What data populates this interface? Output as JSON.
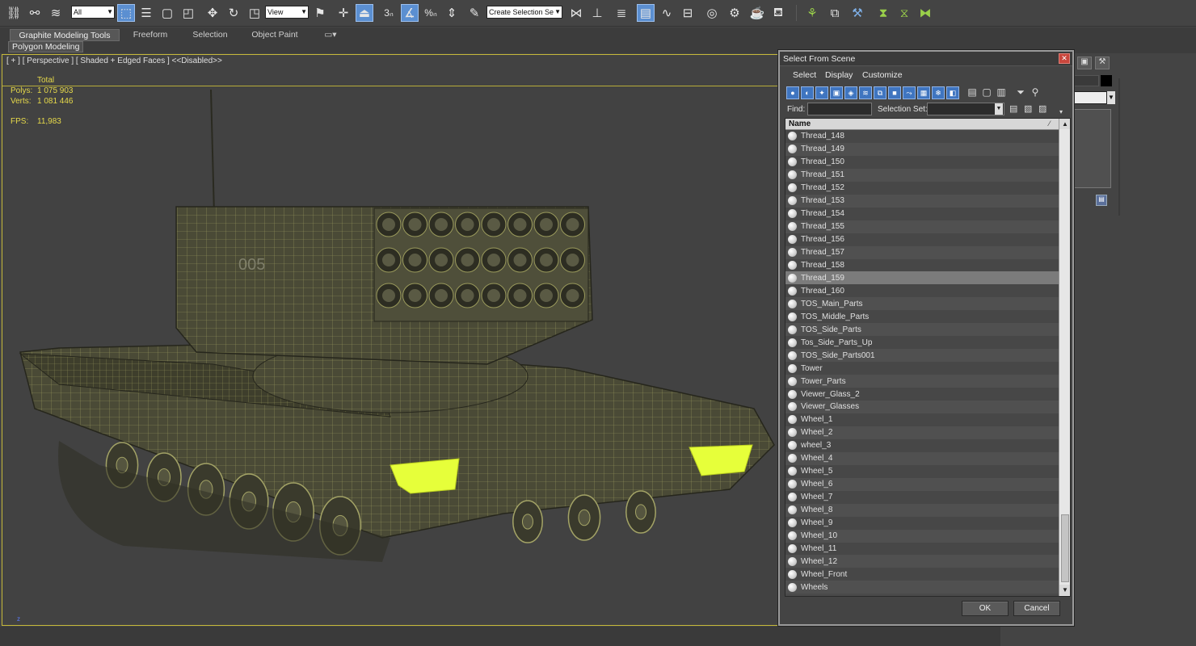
{
  "toolbar": {
    "selection_filter": "All",
    "reference_coord": "View",
    "snap_label": "3",
    "angle_snap": "%",
    "named_selection_placeholder": "Create Selection Se",
    "icons": [
      "link-icon",
      "unlink-icon",
      "bind-spacewarp-icon",
      "select-object-icon",
      "select-by-name-icon",
      "rect-region-icon",
      "window-crossing-icon",
      "move-icon",
      "rotate-icon",
      "scale-icon",
      "select-manipulate-icon",
      "pivot-icon",
      "snap-toggle-icon",
      "angle-snap-icon",
      "percent-snap-icon",
      "spinner-snap-icon",
      "edit-named-sets-icon",
      "mirror-icon",
      "align-icon",
      "layer-manager-icon",
      "graphite-toggle-icon",
      "curve-editor-icon",
      "schematic-view-icon",
      "material-editor-icon",
      "render-setup-icon",
      "rendered-frame-icon",
      "render-icon",
      "render-iterative-icon"
    ]
  },
  "ribbon": {
    "tabs": [
      "Graphite Modeling Tools",
      "Freeform",
      "Selection",
      "Object Paint"
    ],
    "active_tab": "Graphite Modeling Tools",
    "panel_label": "Polygon Modeling"
  },
  "viewport": {
    "label": "[ + ] [ Perspective ] [ Shaded + Edged Faces ] <<Disabled>>",
    "stats_header": "Total",
    "polys_label": "Polys:",
    "polys_value": "1 075 903",
    "verts_label": "Verts:",
    "verts_value": "1 081 446",
    "fps_label": "FPS:",
    "fps_value": "11,983",
    "hull_number": "005",
    "axis_label": "z"
  },
  "dialog": {
    "title": "Select From Scene",
    "menu": [
      "Select",
      "Display",
      "Customize"
    ],
    "find_label": "Find:",
    "find_value": "",
    "selection_set_label": "Selection Set:",
    "selection_set_value": "",
    "column_header": "Name",
    "items": [
      "Thread_148",
      "Thread_149",
      "Thread_150",
      "Thread_151",
      "Thread_152",
      "Thread_153",
      "Thread_154",
      "Thread_155",
      "Thread_156",
      "Thread_157",
      "Thread_158",
      "Thread_159",
      "Thread_160",
      "TOS_Main_Parts",
      "TOS_Middle_Parts",
      "TOS_Side_Parts",
      "Tos_Side_Parts_Up",
      "TOS_Side_Parts001",
      "Tower",
      "Tower_Parts",
      "Viewer_Glass_2",
      "Viewer_Glasses",
      "Wheel_1",
      "Wheel_2",
      "wheel_3",
      "Wheel_4",
      "Wheel_5",
      "Wheel_6",
      "Wheel_7",
      "Wheel_8",
      "Wheel_9",
      "Wheel_10",
      "Wheel_11",
      "Wheel_12",
      "Wheel_Front",
      "Wheels"
    ],
    "selected_item": "Thread_159",
    "ok_label": "OK",
    "cancel_label": "Cancel"
  },
  "colors": {
    "viewport_border": "#c6b93a",
    "stats_text": "#e6d94a",
    "mesh_wire": "#b9b86e",
    "selection_highlight": "#e6ff3a",
    "accent_blue": "#5b8fd1"
  }
}
